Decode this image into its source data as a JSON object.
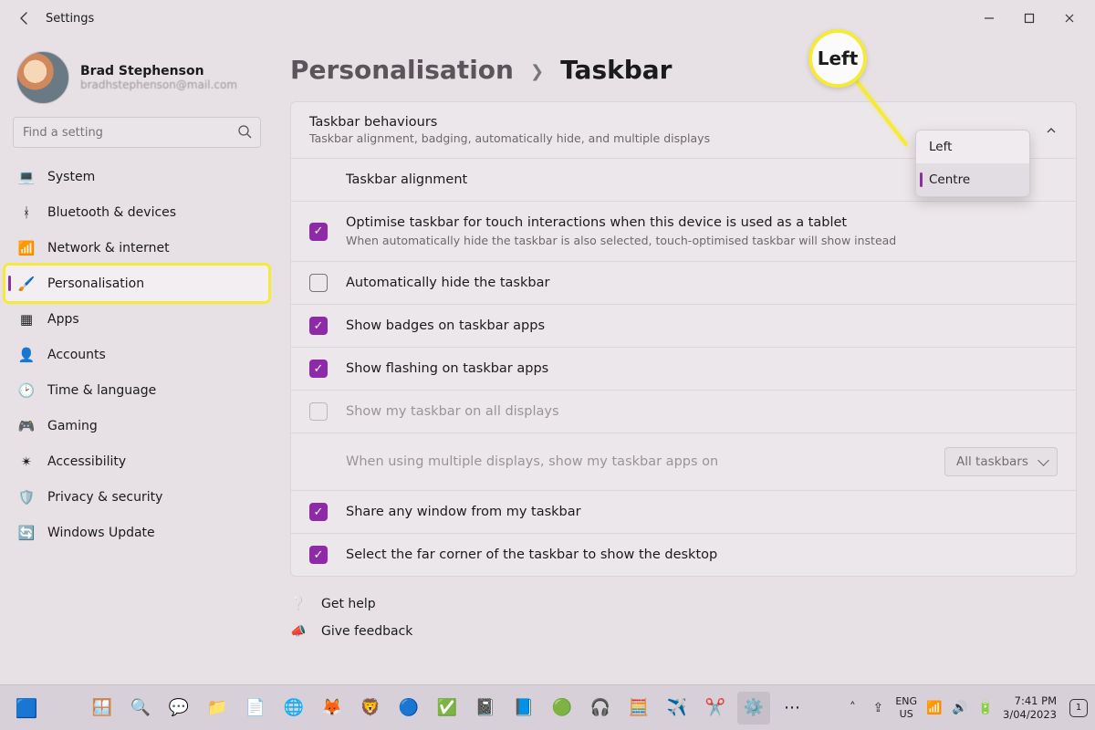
{
  "window": {
    "title": "Settings"
  },
  "account": {
    "name": "Brad Stephenson",
    "email": "bradhstephenson@mail.com"
  },
  "search": {
    "placeholder": "Find a setting"
  },
  "sidebar": {
    "items": [
      {
        "label": "System",
        "icon": "💻",
        "icon_name": "system-icon"
      },
      {
        "label": "Bluetooth & devices",
        "icon": "ᚼ",
        "icon_name": "bluetooth-icon"
      },
      {
        "label": "Network & internet",
        "icon": "📶",
        "icon_name": "wifi-icon"
      },
      {
        "label": "Personalisation",
        "icon": "🖌️",
        "icon_name": "brush-icon",
        "selected": true
      },
      {
        "label": "Apps",
        "icon": "▦",
        "icon_name": "apps-icon"
      },
      {
        "label": "Accounts",
        "icon": "👤",
        "icon_name": "accounts-icon"
      },
      {
        "label": "Time & language",
        "icon": "🕑",
        "icon_name": "clock-icon"
      },
      {
        "label": "Gaming",
        "icon": "🎮",
        "icon_name": "gaming-icon"
      },
      {
        "label": "Accessibility",
        "icon": "✴",
        "icon_name": "accessibility-icon"
      },
      {
        "label": "Privacy & security",
        "icon": "🛡️",
        "icon_name": "shield-icon"
      },
      {
        "label": "Windows Update",
        "icon": "🔄",
        "icon_name": "update-icon"
      }
    ]
  },
  "breadcrumb": {
    "parent": "Personalisation",
    "current": "Taskbar"
  },
  "panel": {
    "title": "Taskbar behaviours",
    "subtitle": "Taskbar alignment, badging, automatically hide, and multiple displays"
  },
  "rows": {
    "alignment_label": "Taskbar alignment",
    "alignment_dropdown": {
      "options": [
        "Left",
        "Centre"
      ],
      "selected": "Centre"
    },
    "optimise": {
      "label": "Optimise taskbar for touch interactions when this device is used as a tablet",
      "sub": "When automatically hide the taskbar is also selected, touch-optimised taskbar will show instead",
      "checked": true
    },
    "autohide": {
      "label": "Automatically hide the taskbar",
      "checked": false
    },
    "badges": {
      "label": "Show badges on taskbar apps",
      "checked": true
    },
    "flashing": {
      "label": "Show flashing on taskbar apps",
      "checked": true
    },
    "alldisp": {
      "label": "Show my taskbar on all displays",
      "checked": false,
      "disabled": true
    },
    "multi": {
      "label": "When using multiple displays, show my taskbar apps on",
      "dropdown": "All taskbars",
      "disabled": true
    },
    "share": {
      "label": "Share any window from my taskbar",
      "checked": true
    },
    "farcorner": {
      "label": "Select the far corner of the taskbar to show the desktop",
      "checked": true
    }
  },
  "links": {
    "help": "Get help",
    "feedback": "Give feedback"
  },
  "callout": {
    "text": "Left"
  },
  "taskbar": {
    "lang1": "ENG",
    "lang2": "US",
    "time": "7:41 PM",
    "date": "3/04/2023",
    "notif_count": "1"
  }
}
